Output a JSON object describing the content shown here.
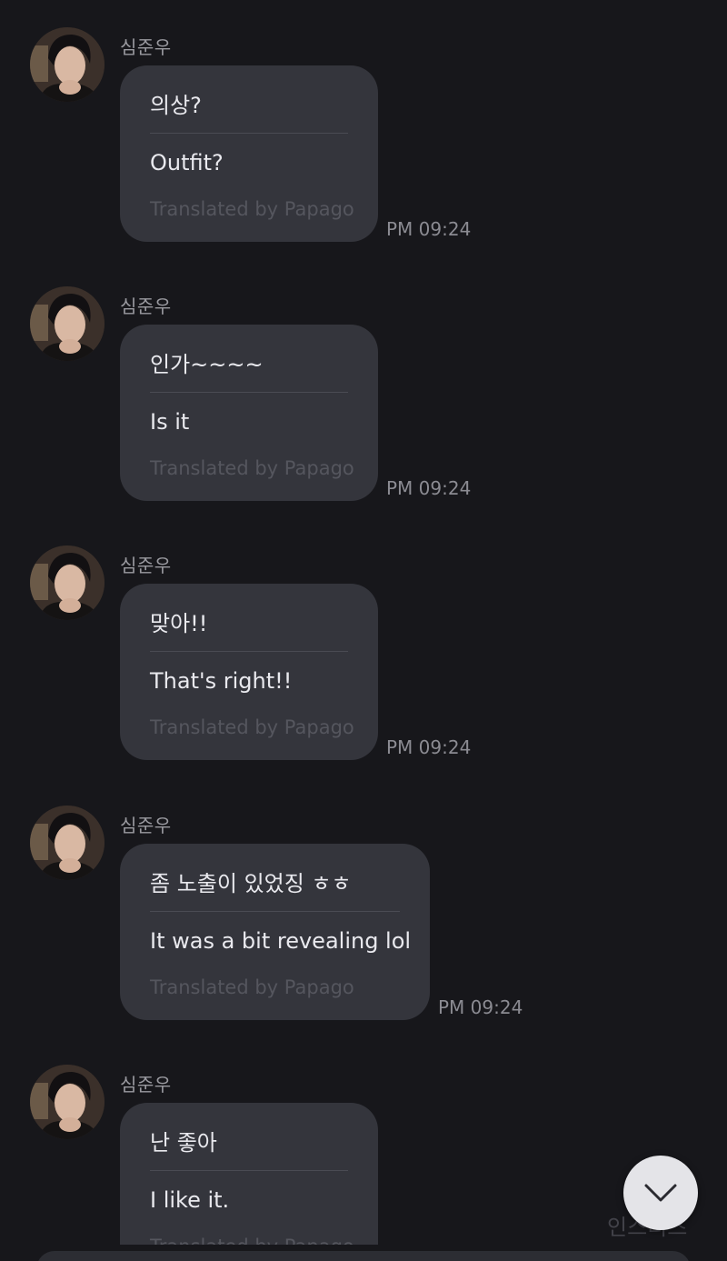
{
  "chat": {
    "credit_label": "Translated by Papago",
    "messages": [
      {
        "sender": "심준우",
        "original": "의상?",
        "translation": "Outfit?",
        "time": "PM 09:24"
      },
      {
        "sender": "심준우",
        "original": "인가~~~~",
        "translation": "Is it",
        "time": "PM 09:24"
      },
      {
        "sender": "심준우",
        "original": "맞아!!",
        "translation": "That's right!!",
        "time": "PM 09:24"
      },
      {
        "sender": "심준우",
        "original": "좀 노출이 있었징 ㅎㅎ",
        "translation": "It was a bit revealing lol",
        "time": "PM 09:24"
      },
      {
        "sender": "심준우",
        "original": "난 좋아",
        "translation": "I like it.",
        "time": ""
      }
    ]
  },
  "scroll_button": {
    "icon": "chevron-down-icon"
  },
  "watermark": {
    "text": "인스티즈"
  },
  "colors": {
    "background": "#17171b",
    "bubble": "#34353c",
    "text": "#e9e9ee",
    "muted": "#8b8b92"
  }
}
